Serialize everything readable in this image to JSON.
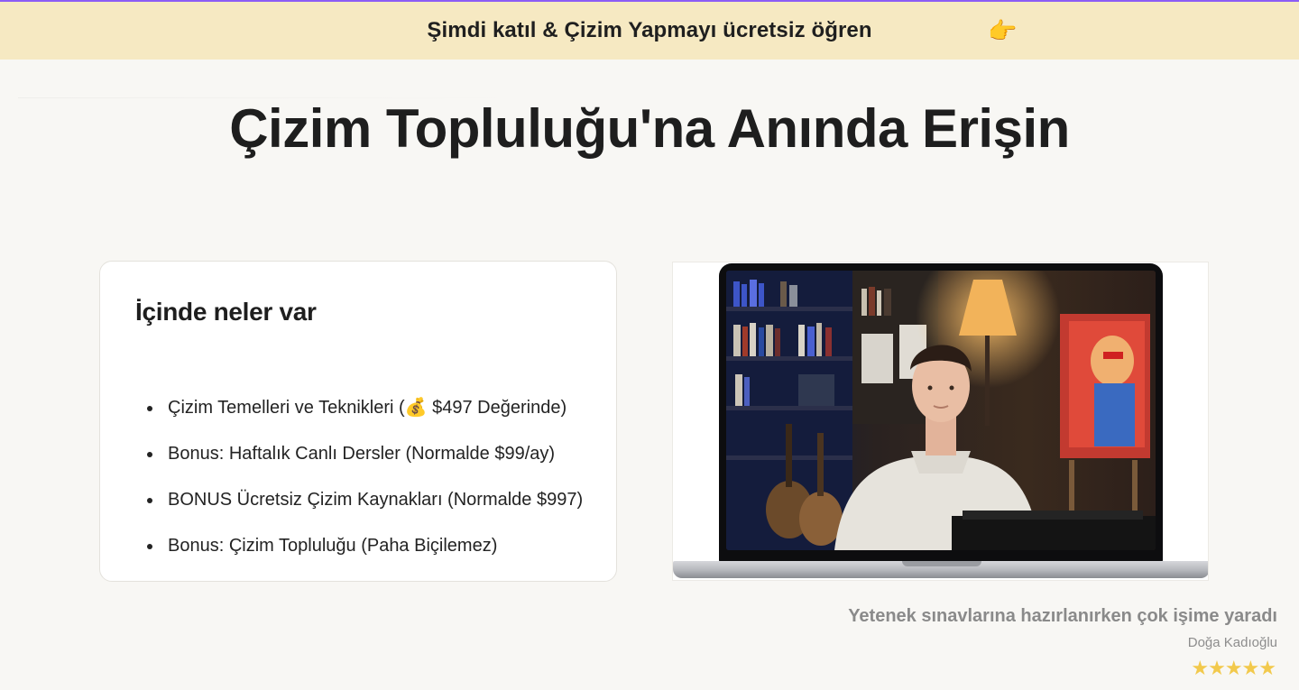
{
  "banner": {
    "text": "Şimdi katıl & Çizim Yapmayı ücretsiz öğren",
    "icon": "👉",
    "icon_name": "pointing-hand-icon"
  },
  "hero": {
    "title": "Çizim Topluluğu'na Anında Erişin"
  },
  "contents_card": {
    "heading": "İçinde neler var",
    "items": [
      "Çizim Temelleri ve Teknikleri (💰 $497 Değerinde)",
      "Bonus: Haftalık Canlı Dersler (Normalde $99/ay)",
      "BONUS Ücretsiz Çizim Kaynakları (Normalde $997)",
      "Bonus: Çizim Topluluğu (Paha Biçilemez)"
    ]
  },
  "media": {
    "type": "laptop-video-mockup"
  },
  "testimonial": {
    "quote": "Yetenek sınavlarına hazırlanırken çok işime yaradı",
    "author": "Doğa Kadıoğlu",
    "stars": "★★★★★",
    "rating": 5
  },
  "colors": {
    "banner_bg": "#f6e9c2",
    "accent_line": "#8b5cf6",
    "page_bg": "#f8f7f4",
    "star": "#f2c94c"
  }
}
